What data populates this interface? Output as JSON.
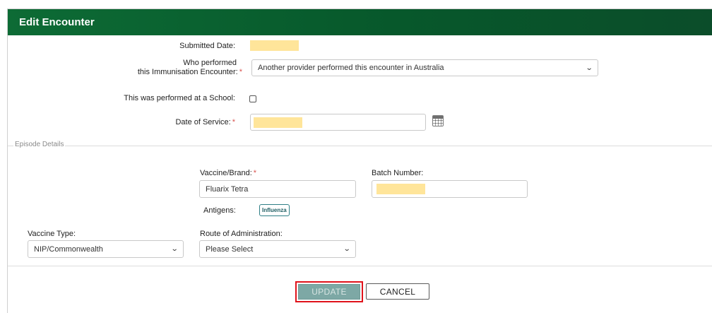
{
  "header": {
    "title": "Edit Encounter"
  },
  "form": {
    "submitted_date_label": "Submitted Date:",
    "who_performed_label_line1": "Who performed",
    "who_performed_label_line2": "this Immunisation Encounter:",
    "who_performed_value": "Another provider performed this encounter in Australia",
    "school_label": "This was performed at a School:",
    "school_checked": false,
    "date_of_service_label": "Date of Service:",
    "required_marker": "*"
  },
  "episode": {
    "legend": "Episode Details",
    "vaccine_brand_label": "Vaccine/Brand:",
    "vaccine_brand_value": "Fluarix Tetra",
    "batch_number_label": "Batch Number:",
    "antigens_label": "Antigens:",
    "antigen_badge": "Influenza",
    "vaccine_type_label": "Vaccine Type:",
    "vaccine_type_value": "NIP/Commonwealth",
    "route_label": "Route of Administration:",
    "route_value": "Please Select"
  },
  "actions": {
    "update_label": "UPDATE",
    "cancel_label": "CANCEL"
  },
  "colors": {
    "header_green": "#07582b",
    "redacted_highlight": "#ffe59a",
    "update_disabled": "#7da8a5",
    "focus_outline": "#e0131b",
    "required": "#d9534f"
  },
  "icons": {
    "calendar": "calendar-icon",
    "dropdown": "chevron-down-icon"
  }
}
